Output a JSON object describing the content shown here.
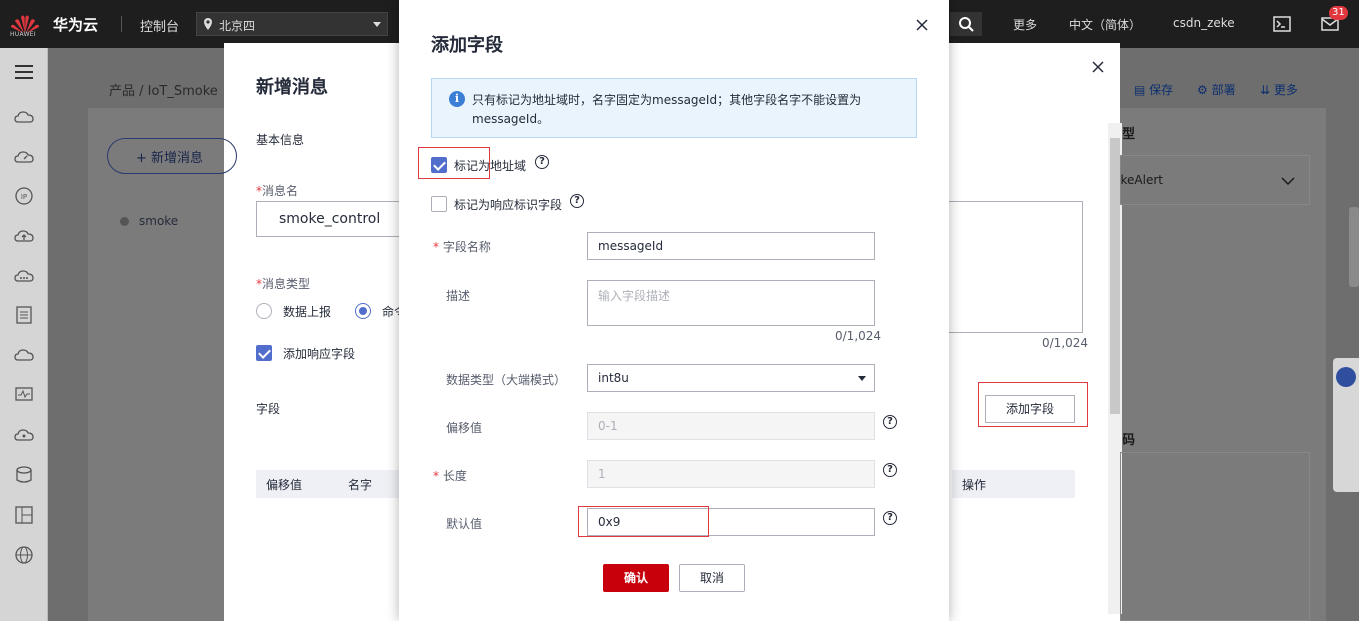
{
  "topbar": {
    "logo_text": "HUAWEI",
    "brand": "华为云",
    "console": "控制台",
    "region": "北京四",
    "more": "更多",
    "language": "中文（简体）",
    "user": "csdn_zeke",
    "badge_count": "31"
  },
  "page": {
    "breadcrumb": "产品 / IoT_Smoke",
    "toolbar": {
      "save": "保存",
      "deploy": "部署",
      "more": "更多"
    },
    "add_message_button": "新增消息",
    "message_list": [
      "smoke"
    ]
  },
  "drawer": {
    "title": "新增消息",
    "basic_info": "基本信息",
    "msg_name_label": "消息名",
    "msg_name_value": "smoke_control",
    "msg_type_label": "消息类型",
    "msg_type_options": [
      "数据上报",
      "命令下发"
    ],
    "msg_type_selected": "命令下发",
    "add_response_label": "添加响应字段",
    "fields_label": "字段",
    "table_headers": [
      "偏移值",
      "名字",
      "操作"
    ],
    "textarea_count": "0/1,024",
    "add_field_button": "添加字段",
    "right_select_value": "SmokeAlert",
    "right_header_1": "类型",
    "right_header_2": "编码"
  },
  "dialog": {
    "title": "添加字段",
    "info": "只有标记为地址域时，名字固定为messageId；其他字段名字不能设置为messageId。",
    "mark_address": "标记为地址域",
    "mark_address_checked": true,
    "mark_response": "标记为响应标识字段",
    "mark_response_checked": false,
    "field_name_label": "字段名称",
    "field_name_value": "messageId",
    "desc_label": "描述",
    "desc_placeholder": "输入字段描述",
    "desc_count": "0/1,024",
    "data_type_label": "数据类型（大端模式）",
    "data_type_value": "int8u",
    "offset_label": "偏移值",
    "offset_value": "0-1",
    "length_label": "长度",
    "length_value": "1",
    "default_label": "默认值",
    "default_value": "0x9",
    "confirm": "确认",
    "cancel": "取消"
  },
  "colors": {
    "primary": "#c7000b",
    "accent": "#526ecc",
    "highlight": "#e0383e"
  }
}
